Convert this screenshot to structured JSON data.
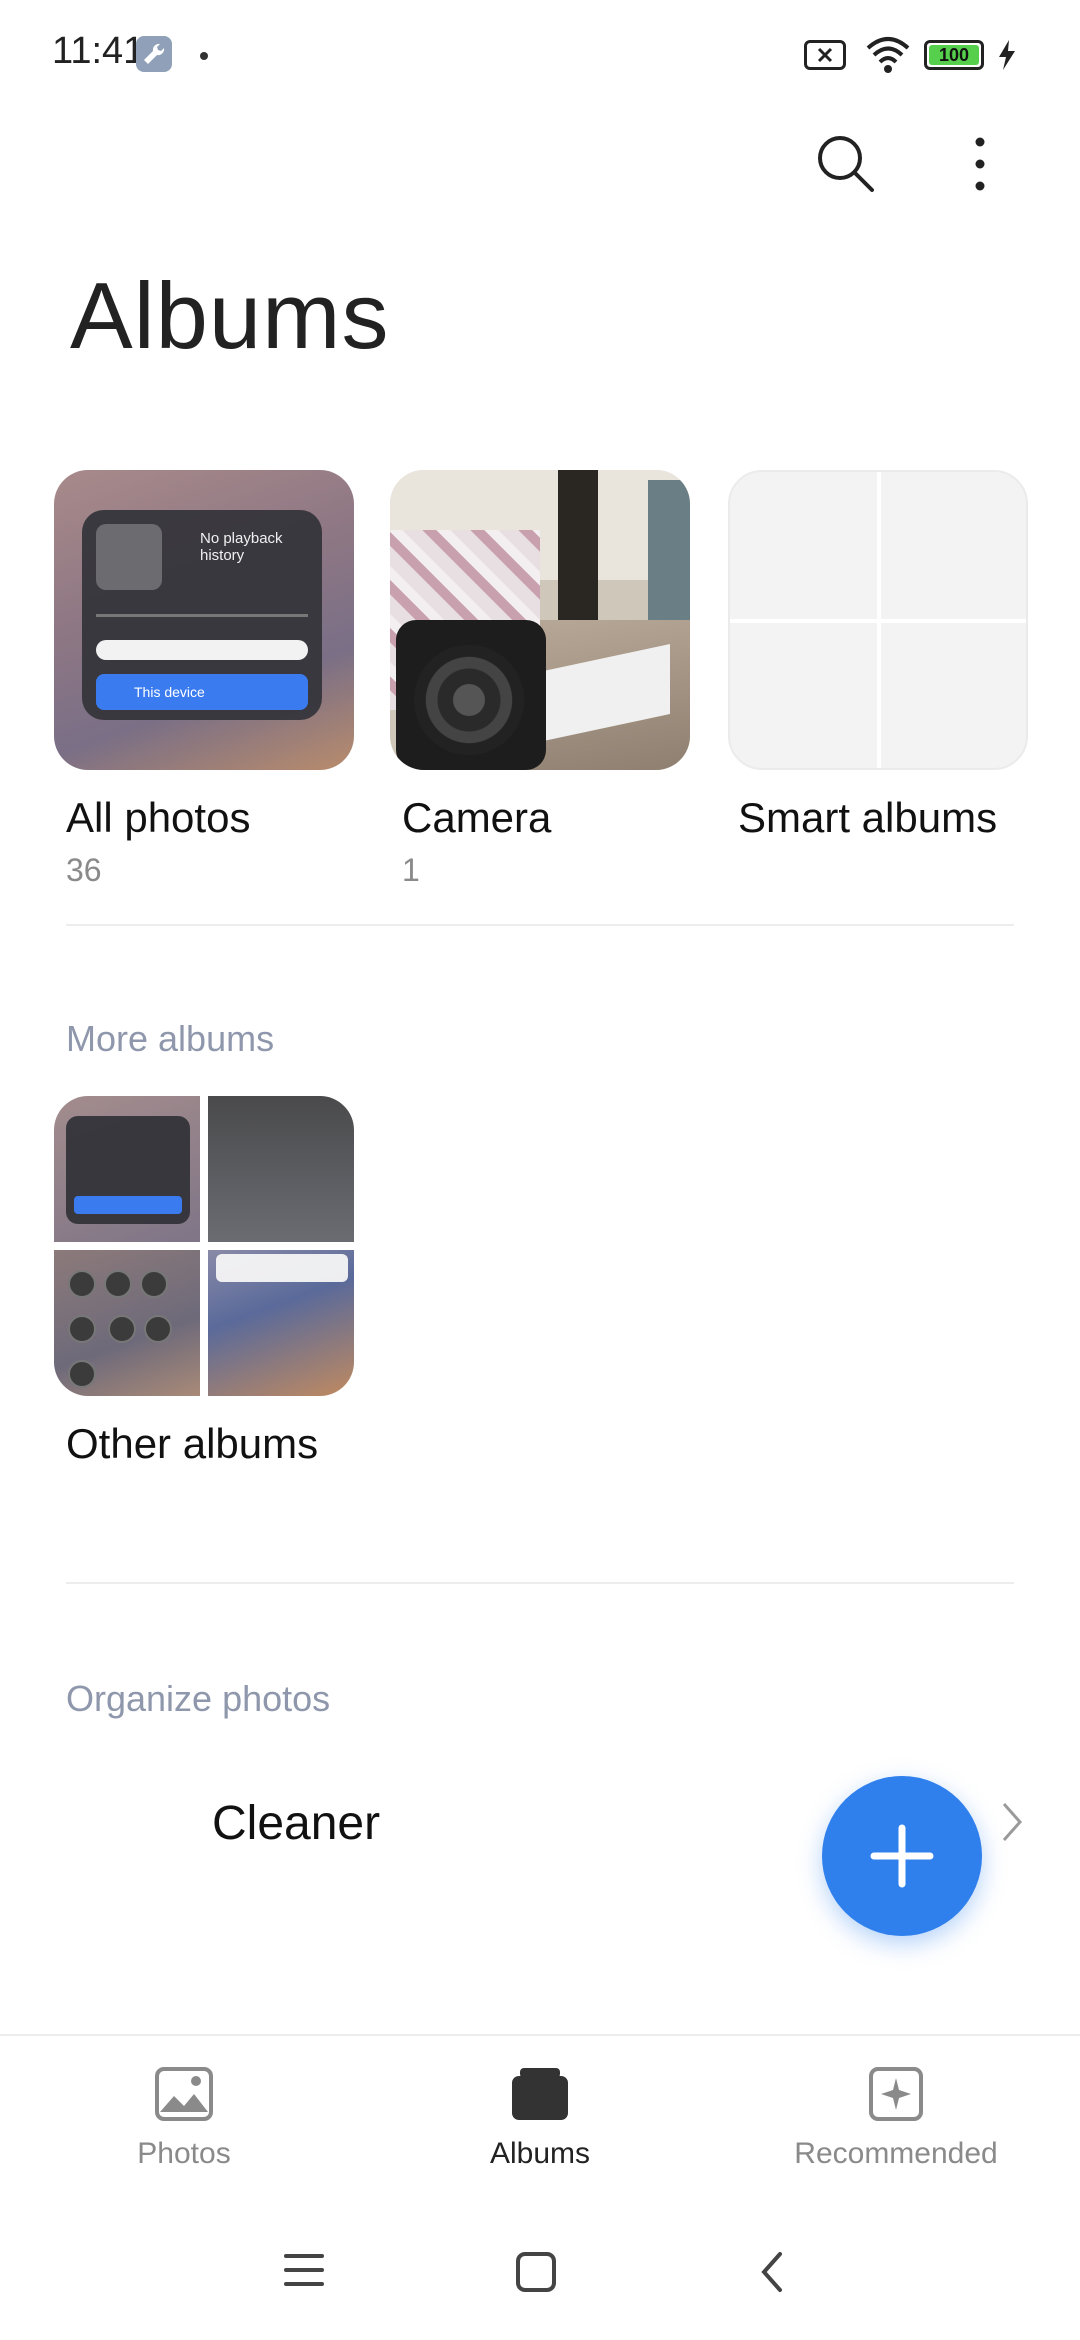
{
  "status_bar": {
    "time": "11:41",
    "battery": "100"
  },
  "header": {
    "title": "Albums"
  },
  "albums": [
    {
      "name": "All photos",
      "count": "36"
    },
    {
      "name": "Camera",
      "count": "1"
    },
    {
      "name": "Smart albums",
      "count": ""
    }
  ],
  "all_photos_thumb": {
    "player_title": "No playback history",
    "device_button": "This device"
  },
  "more_albums": {
    "label": "More albums",
    "items": [
      {
        "name": "Other albums"
      }
    ]
  },
  "organize": {
    "label": "Organize photos",
    "cleaner_label": "Cleaner"
  },
  "bottom_nav": {
    "photos": "Photos",
    "albums": "Albums",
    "recommended": "Recommended",
    "active": "albums"
  },
  "colors": {
    "accent": "#2f80ed",
    "section_label": "#8e97ab"
  }
}
